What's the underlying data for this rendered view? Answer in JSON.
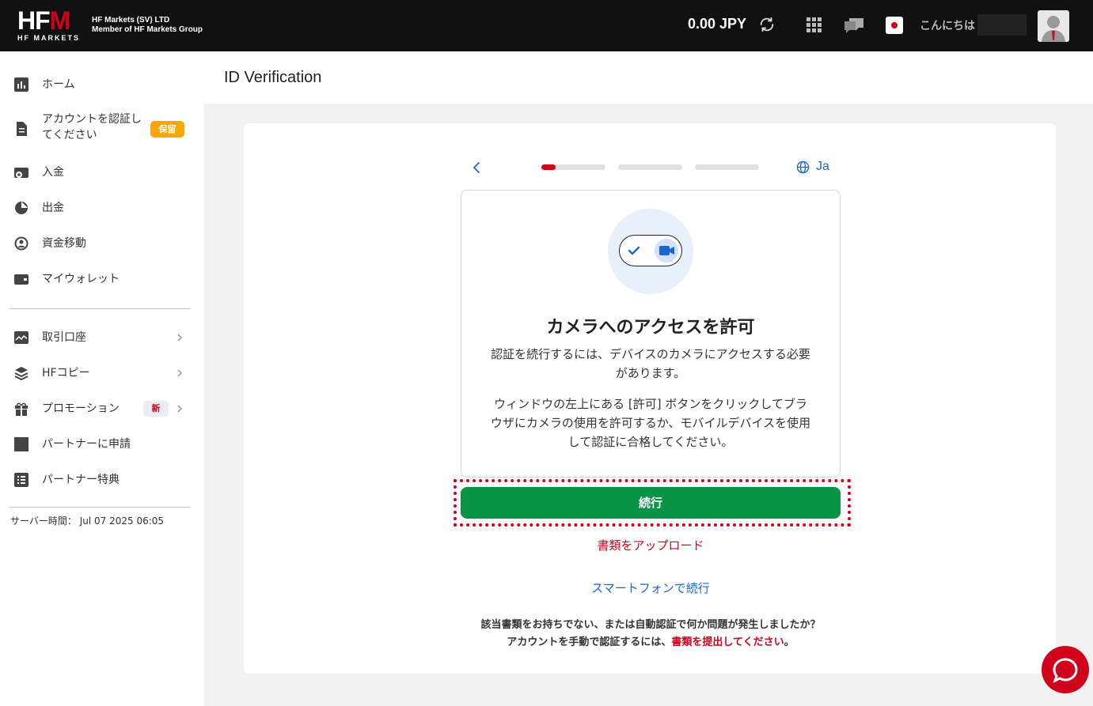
{
  "header": {
    "logo_main": "HFM",
    "logo_sub": "HF MARKETS",
    "company_line1": "HF Markets (SV) LTD",
    "company_line2": "Member of HF Markets Group",
    "balance": "0.00 JPY",
    "greeting": "こんにちは",
    "icons": [
      "refresh-icon",
      "apps-grid-icon",
      "chat-icon",
      "japan-flag-icon",
      "avatar"
    ]
  },
  "sidebar": {
    "items": [
      {
        "label": "ホーム",
        "icon": "home-chart-icon"
      },
      {
        "label": "アカウントを認証してください",
        "badge": "保留",
        "icon": "document-icon"
      },
      {
        "label": "入金",
        "icon": "deposit-icon"
      },
      {
        "label": "出金",
        "icon": "withdraw-icon"
      },
      {
        "label": "資金移動",
        "icon": "transfer-icon"
      },
      {
        "label": "マイウォレット",
        "icon": "wallet-icon"
      },
      {
        "label": "取引口座",
        "icon": "trading-account-icon"
      },
      {
        "label": "HFコピー",
        "icon": "layers-icon"
      },
      {
        "label": "プロモーション",
        "badge": "新",
        "icon": "gift-icon"
      },
      {
        "label": "パートナーに申請",
        "icon": "partner-icon"
      },
      {
        "label": "パートナー特典",
        "icon": "list-icon"
      }
    ],
    "server_time_label": "サーバー時間：",
    "server_time": "Jul 07 2025 06:05"
  },
  "page": {
    "title": "ID Verification"
  },
  "verification": {
    "progress_steps": [
      0.22,
      0,
      0
    ],
    "language": "Ja",
    "heading": "カメラへのアクセスを許可",
    "desc1_line1": "認証を続行するには、デバイスのカメラにアクセスする必要",
    "desc1_line2": "があります。",
    "desc2_line1": "ウィンドウの左上にある [許可] ボタンをクリックしてブラ",
    "desc2_line2": "ウザにカメラの使用を許可するか、モバイルデバイスを使用",
    "desc2_line3": "して認証に合格してください。",
    "continue_label": "続行",
    "upload_label": "書類をアップロード",
    "phone_label": "スマートフォンで続行",
    "footer_line1": "該当書類をお持ちでない、または自動認証で何か問題が発生しましたか？",
    "footer_line2_prefix": "アカウントを手動で認証するには、",
    "footer_line2_link": "書類を提出してください",
    "footer_line2_suffix": "。"
  },
  "colors": {
    "brand_red": "#d0021b",
    "button_green": "#099346",
    "link_blue": "#1a66d6",
    "badge_orange": "#f6a800"
  }
}
